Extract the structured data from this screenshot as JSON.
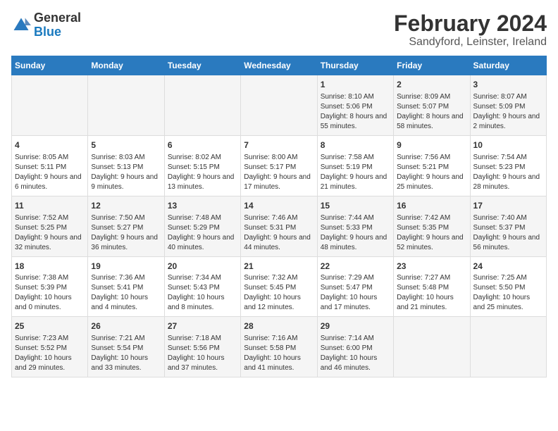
{
  "logo": {
    "text_general": "General",
    "text_blue": "Blue"
  },
  "header": {
    "title": "February 2024",
    "subtitle": "Sandyford, Leinster, Ireland"
  },
  "days_of_week": [
    "Sunday",
    "Monday",
    "Tuesday",
    "Wednesday",
    "Thursday",
    "Friday",
    "Saturday"
  ],
  "weeks": [
    [
      {
        "day": "",
        "sunrise": "",
        "sunset": "",
        "daylight": ""
      },
      {
        "day": "",
        "sunrise": "",
        "sunset": "",
        "daylight": ""
      },
      {
        "day": "",
        "sunrise": "",
        "sunset": "",
        "daylight": ""
      },
      {
        "day": "",
        "sunrise": "",
        "sunset": "",
        "daylight": ""
      },
      {
        "day": "1",
        "sunrise": "Sunrise: 8:10 AM",
        "sunset": "Sunset: 5:06 PM",
        "daylight": "Daylight: 8 hours and 55 minutes."
      },
      {
        "day": "2",
        "sunrise": "Sunrise: 8:09 AM",
        "sunset": "Sunset: 5:07 PM",
        "daylight": "Daylight: 8 hours and 58 minutes."
      },
      {
        "day": "3",
        "sunrise": "Sunrise: 8:07 AM",
        "sunset": "Sunset: 5:09 PM",
        "daylight": "Daylight: 9 hours and 2 minutes."
      }
    ],
    [
      {
        "day": "4",
        "sunrise": "Sunrise: 8:05 AM",
        "sunset": "Sunset: 5:11 PM",
        "daylight": "Daylight: 9 hours and 6 minutes."
      },
      {
        "day": "5",
        "sunrise": "Sunrise: 8:03 AM",
        "sunset": "Sunset: 5:13 PM",
        "daylight": "Daylight: 9 hours and 9 minutes."
      },
      {
        "day": "6",
        "sunrise": "Sunrise: 8:02 AM",
        "sunset": "Sunset: 5:15 PM",
        "daylight": "Daylight: 9 hours and 13 minutes."
      },
      {
        "day": "7",
        "sunrise": "Sunrise: 8:00 AM",
        "sunset": "Sunset: 5:17 PM",
        "daylight": "Daylight: 9 hours and 17 minutes."
      },
      {
        "day": "8",
        "sunrise": "Sunrise: 7:58 AM",
        "sunset": "Sunset: 5:19 PM",
        "daylight": "Daylight: 9 hours and 21 minutes."
      },
      {
        "day": "9",
        "sunrise": "Sunrise: 7:56 AM",
        "sunset": "Sunset: 5:21 PM",
        "daylight": "Daylight: 9 hours and 25 minutes."
      },
      {
        "day": "10",
        "sunrise": "Sunrise: 7:54 AM",
        "sunset": "Sunset: 5:23 PM",
        "daylight": "Daylight: 9 hours and 28 minutes."
      }
    ],
    [
      {
        "day": "11",
        "sunrise": "Sunrise: 7:52 AM",
        "sunset": "Sunset: 5:25 PM",
        "daylight": "Daylight: 9 hours and 32 minutes."
      },
      {
        "day": "12",
        "sunrise": "Sunrise: 7:50 AM",
        "sunset": "Sunset: 5:27 PM",
        "daylight": "Daylight: 9 hours and 36 minutes."
      },
      {
        "day": "13",
        "sunrise": "Sunrise: 7:48 AM",
        "sunset": "Sunset: 5:29 PM",
        "daylight": "Daylight: 9 hours and 40 minutes."
      },
      {
        "day": "14",
        "sunrise": "Sunrise: 7:46 AM",
        "sunset": "Sunset: 5:31 PM",
        "daylight": "Daylight: 9 hours and 44 minutes."
      },
      {
        "day": "15",
        "sunrise": "Sunrise: 7:44 AM",
        "sunset": "Sunset: 5:33 PM",
        "daylight": "Daylight: 9 hours and 48 minutes."
      },
      {
        "day": "16",
        "sunrise": "Sunrise: 7:42 AM",
        "sunset": "Sunset: 5:35 PM",
        "daylight": "Daylight: 9 hours and 52 minutes."
      },
      {
        "day": "17",
        "sunrise": "Sunrise: 7:40 AM",
        "sunset": "Sunset: 5:37 PM",
        "daylight": "Daylight: 9 hours and 56 minutes."
      }
    ],
    [
      {
        "day": "18",
        "sunrise": "Sunrise: 7:38 AM",
        "sunset": "Sunset: 5:39 PM",
        "daylight": "Daylight: 10 hours and 0 minutes."
      },
      {
        "day": "19",
        "sunrise": "Sunrise: 7:36 AM",
        "sunset": "Sunset: 5:41 PM",
        "daylight": "Daylight: 10 hours and 4 minutes."
      },
      {
        "day": "20",
        "sunrise": "Sunrise: 7:34 AM",
        "sunset": "Sunset: 5:43 PM",
        "daylight": "Daylight: 10 hours and 8 minutes."
      },
      {
        "day": "21",
        "sunrise": "Sunrise: 7:32 AM",
        "sunset": "Sunset: 5:45 PM",
        "daylight": "Daylight: 10 hours and 12 minutes."
      },
      {
        "day": "22",
        "sunrise": "Sunrise: 7:29 AM",
        "sunset": "Sunset: 5:47 PM",
        "daylight": "Daylight: 10 hours and 17 minutes."
      },
      {
        "day": "23",
        "sunrise": "Sunrise: 7:27 AM",
        "sunset": "Sunset: 5:48 PM",
        "daylight": "Daylight: 10 hours and 21 minutes."
      },
      {
        "day": "24",
        "sunrise": "Sunrise: 7:25 AM",
        "sunset": "Sunset: 5:50 PM",
        "daylight": "Daylight: 10 hours and 25 minutes."
      }
    ],
    [
      {
        "day": "25",
        "sunrise": "Sunrise: 7:23 AM",
        "sunset": "Sunset: 5:52 PM",
        "daylight": "Daylight: 10 hours and 29 minutes."
      },
      {
        "day": "26",
        "sunrise": "Sunrise: 7:21 AM",
        "sunset": "Sunset: 5:54 PM",
        "daylight": "Daylight: 10 hours and 33 minutes."
      },
      {
        "day": "27",
        "sunrise": "Sunrise: 7:18 AM",
        "sunset": "Sunset: 5:56 PM",
        "daylight": "Daylight: 10 hours and 37 minutes."
      },
      {
        "day": "28",
        "sunrise": "Sunrise: 7:16 AM",
        "sunset": "Sunset: 5:58 PM",
        "daylight": "Daylight: 10 hours and 41 minutes."
      },
      {
        "day": "29",
        "sunrise": "Sunrise: 7:14 AM",
        "sunset": "Sunset: 6:00 PM",
        "daylight": "Daylight: 10 hours and 46 minutes."
      },
      {
        "day": "",
        "sunrise": "",
        "sunset": "",
        "daylight": ""
      },
      {
        "day": "",
        "sunrise": "",
        "sunset": "",
        "daylight": ""
      }
    ]
  ]
}
